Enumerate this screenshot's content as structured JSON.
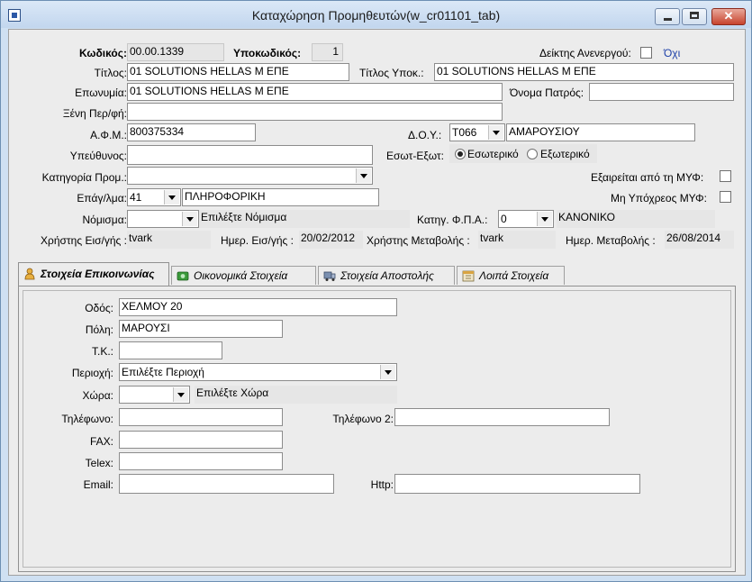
{
  "window": {
    "title": "Καταχώρηση Προμηθευτών(w_cr01101_tab)",
    "min_glyph": "",
    "max_glyph": "",
    "close_glyph": "✕"
  },
  "header": {
    "code_label": "Κωδικός:",
    "code_value": "00.00.1339",
    "subcode_label": "Υποκωδικός:",
    "subcode_value": "1",
    "inactive_label": "Δείκτης Ανενεργού:",
    "inactive_value": "Όχι",
    "title_label": "Τίτλος:",
    "title_value": "01 SOLUTIONS HELLAS Μ ΕΠΕ",
    "subtitle_label": "Τίτλος Υποκ.:",
    "subtitle_value": "01 SOLUTIONS HELLAS Μ ΕΠΕ",
    "name_label": "Επωνυμία:",
    "name_value": "01 SOLUTIONS HELLAS Μ ΕΠΕ",
    "father_label": "Όνομα Πατρός:",
    "father_value": "",
    "foreign_label": "Ξένη Περ/φή:",
    "foreign_value": "",
    "afm_label": "Α.Φ.Μ.:",
    "afm_value": "800375334",
    "doy_label": "Δ.Ο.Υ.:",
    "doy_code": "Τ066",
    "doy_name": "ΑΜΑΡΟΥΣΙΟΥ",
    "responsible_label": "Υπεύθυνος:",
    "responsible_value": "",
    "internal_label": "Εσωτ-Εξωτ:",
    "internal_option": "Εσωτερικό",
    "external_option": "Εξωτερικό",
    "category_label": "Κατηγορία Προμ.:",
    "category_value": "",
    "myf_exempt_label": "Εξαιρείται από τη ΜΥΦ:",
    "profession_label": "Επάγ/λμα:",
    "profession_code": "41",
    "profession_name": "ΠΛΗΡΟΦΟΡΙΚΗ",
    "myf_not_label": "Μη Υπόχρεος ΜΥΦ:",
    "currency_label": "Νόμισμα:",
    "currency_value": "",
    "currency_hint": "Επιλέξτε Νόμισμα",
    "vat_label": "Κατηγ. Φ.Π.Α.:",
    "vat_code": "0",
    "vat_name": "ΚΑΝΟΝΙΚΟ",
    "entry_user_label": "Χρήστης Εισ/γής :",
    "entry_user_value": "tvark",
    "entry_date_label": "Ημερ. Εισ/γής :",
    "entry_date_value": "20/02/2012",
    "mod_user_label": "Χρήστης Μεταβολής :",
    "mod_user_value": "tvark",
    "mod_date_label": "Ημερ. Μεταβολής :",
    "mod_date_value": "26/08/2014"
  },
  "tabs": [
    {
      "label": "Στοιχεία Επικοινωνίας",
      "icon": "person-icon"
    },
    {
      "label": "Οικονομικά Στοιχεία",
      "icon": "money-icon"
    },
    {
      "label": "Στοιχεία Αποστολής",
      "icon": "truck-icon"
    },
    {
      "label": "Λοιπά Στοιχεία",
      "icon": "calendar-icon"
    }
  ],
  "contact": {
    "street_label": "Οδός:",
    "street_value": "ΧΕΛΜΟΥ 20",
    "city_label": "Πόλη:",
    "city_value": "ΜΑΡΟΥΣΙ",
    "zip_label": "Τ.Κ.:",
    "zip_value": "",
    "region_label": "Περιοχή:",
    "region_value": "Επιλέξτε Περιοχή",
    "country_label": "Χώρα:",
    "country_value": "",
    "country_hint": "Επιλέξτε Χώρα",
    "phone_label": "Τηλέφωνο:",
    "phone_value": "",
    "phone2_label": "Τηλέφωνο 2:",
    "phone2_value": "",
    "fax_label": "FAX:",
    "fax_value": "",
    "telex_label": "Telex:",
    "telex_value": "",
    "email_label": "Email:",
    "email_value": "",
    "http_label": "Http:",
    "http_value": ""
  }
}
